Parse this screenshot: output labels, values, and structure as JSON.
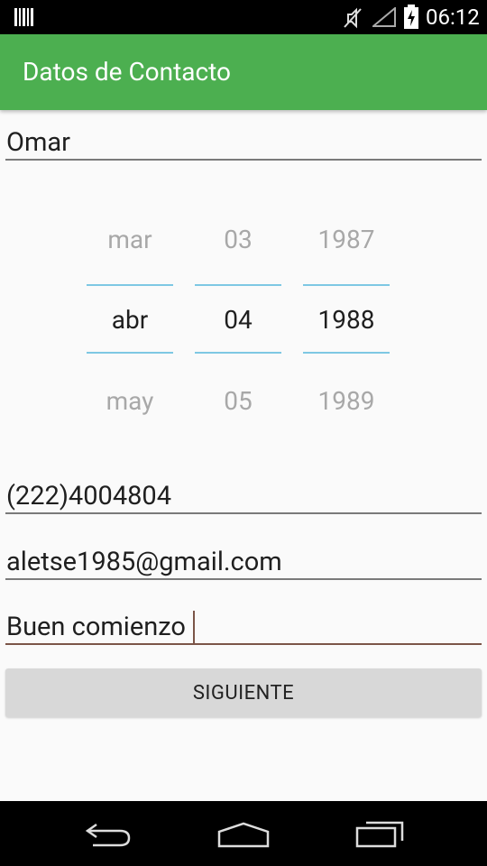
{
  "status_bar": {
    "time": "06:12",
    "icons": [
      "barcode-icon",
      "mute-icon",
      "signal-icon",
      "battery-icon"
    ]
  },
  "app_bar": {
    "title": "Datos de Contacto"
  },
  "form": {
    "name": "Omar",
    "date_picker": {
      "month": {
        "prev": "mar",
        "selected": "abr",
        "next": "may"
      },
      "day": {
        "prev": "03",
        "selected": "04",
        "next": "05"
      },
      "year": {
        "prev": "1987",
        "selected": "1988",
        "next": "1989"
      }
    },
    "phone": "(222)4004804",
    "email": "aletse1985@gmail.com",
    "description": "Buen comienzo",
    "next_button": "SIGUIENTE"
  },
  "nav_bar": {
    "icons": [
      "back-icon",
      "home-icon",
      "recents-icon"
    ]
  },
  "colors": {
    "primary": "#4caf50",
    "accent": "#7b5548",
    "picker_divider": "#7ec8e3"
  }
}
